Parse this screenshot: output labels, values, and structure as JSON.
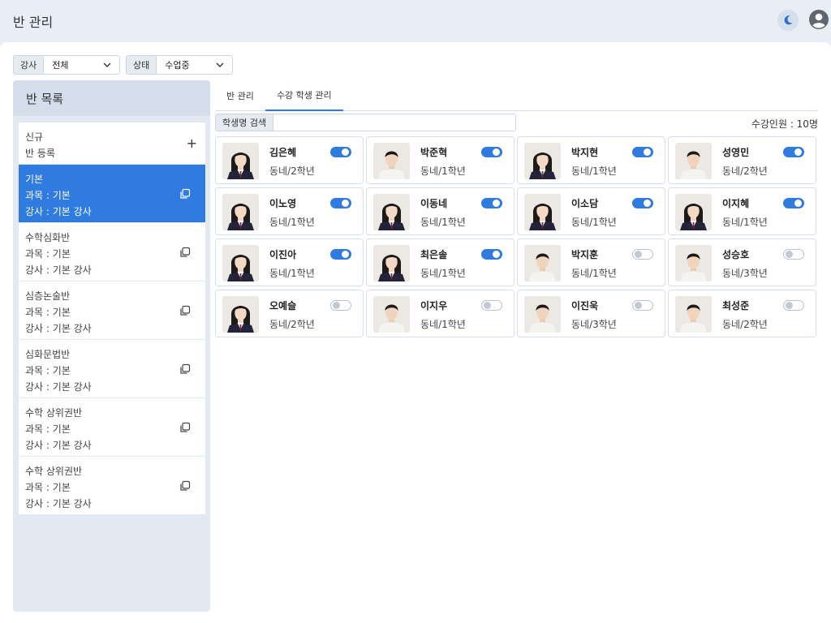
{
  "header": {
    "title": "반 관리",
    "icons": [
      "moon-icon",
      "user-icon"
    ]
  },
  "filters": [
    {
      "label": "강사",
      "value": "전체"
    },
    {
      "label": "상태",
      "value": "수업중"
    }
  ],
  "sidebar": {
    "title": "반 목록",
    "new_item": {
      "line1": "신규",
      "line2": "반 등록"
    },
    "classes": [
      {
        "name": "기본",
        "subject": "과목 : 기본",
        "teacher": "강사 : 기본 강사",
        "active": true
      },
      {
        "name": "수학심화반",
        "subject": "과목 : 기본",
        "teacher": "강사 : 기본 강사",
        "active": false
      },
      {
        "name": "심층논술반",
        "subject": "과목 : 기본",
        "teacher": "강사 : 기본 강사",
        "active": false
      },
      {
        "name": "심화문법반",
        "subject": "과목 : 기본",
        "teacher": "강사 : 기본 강사",
        "active": false
      },
      {
        "name": "수학 상위권반",
        "subject": "과목 : 기본",
        "teacher": "강사 : 기본 강사",
        "active": false
      },
      {
        "name": "수학 상위권반",
        "subject": "과목 : 기본",
        "teacher": "강사 : 기본 강사",
        "active": false
      }
    ]
  },
  "tabs": [
    {
      "label": "반 관리",
      "active": false
    },
    {
      "label": "수강 학생 관리",
      "active": true
    }
  ],
  "search": {
    "label": "학생명 검색",
    "value": ""
  },
  "enrolled_count": "수강인원 : 10명",
  "accent_color": "#2f7be0",
  "students": [
    {
      "name": "김은혜",
      "grade": "동네/2학년",
      "enrolled": true,
      "photo": "female"
    },
    {
      "name": "박준혁",
      "grade": "동네/1학년",
      "enrolled": true,
      "photo": "male"
    },
    {
      "name": "박지현",
      "grade": "동네/1학년",
      "enrolled": true,
      "photo": "female"
    },
    {
      "name": "성영민",
      "grade": "동네/2학년",
      "enrolled": true,
      "photo": "male"
    },
    {
      "name": "이노영",
      "grade": "동네/1학년",
      "enrolled": true,
      "photo": "female"
    },
    {
      "name": "이동네",
      "grade": "동네/1학년",
      "enrolled": true,
      "photo": "female"
    },
    {
      "name": "이소담",
      "grade": "동네/1학년",
      "enrolled": true,
      "photo": "female"
    },
    {
      "name": "이지혜",
      "grade": "동네/1학년",
      "enrolled": true,
      "photo": "female"
    },
    {
      "name": "이진아",
      "grade": "동네/1학년",
      "enrolled": true,
      "photo": "female"
    },
    {
      "name": "최은솔",
      "grade": "동네/1학년",
      "enrolled": true,
      "photo": "female"
    },
    {
      "name": "박지훈",
      "grade": "동네/1학년",
      "enrolled": false,
      "photo": "male"
    },
    {
      "name": "성승호",
      "grade": "동네/3학년",
      "enrolled": false,
      "photo": "male"
    },
    {
      "name": "오예슬",
      "grade": "동네/2학년",
      "enrolled": false,
      "photo": "female"
    },
    {
      "name": "이지우",
      "grade": "동네/1학년",
      "enrolled": false,
      "photo": "male"
    },
    {
      "name": "이진욱",
      "grade": "동네/3학년",
      "enrolled": false,
      "photo": "male"
    },
    {
      "name": "최성준",
      "grade": "동네/2학년",
      "enrolled": false,
      "photo": "male"
    }
  ]
}
